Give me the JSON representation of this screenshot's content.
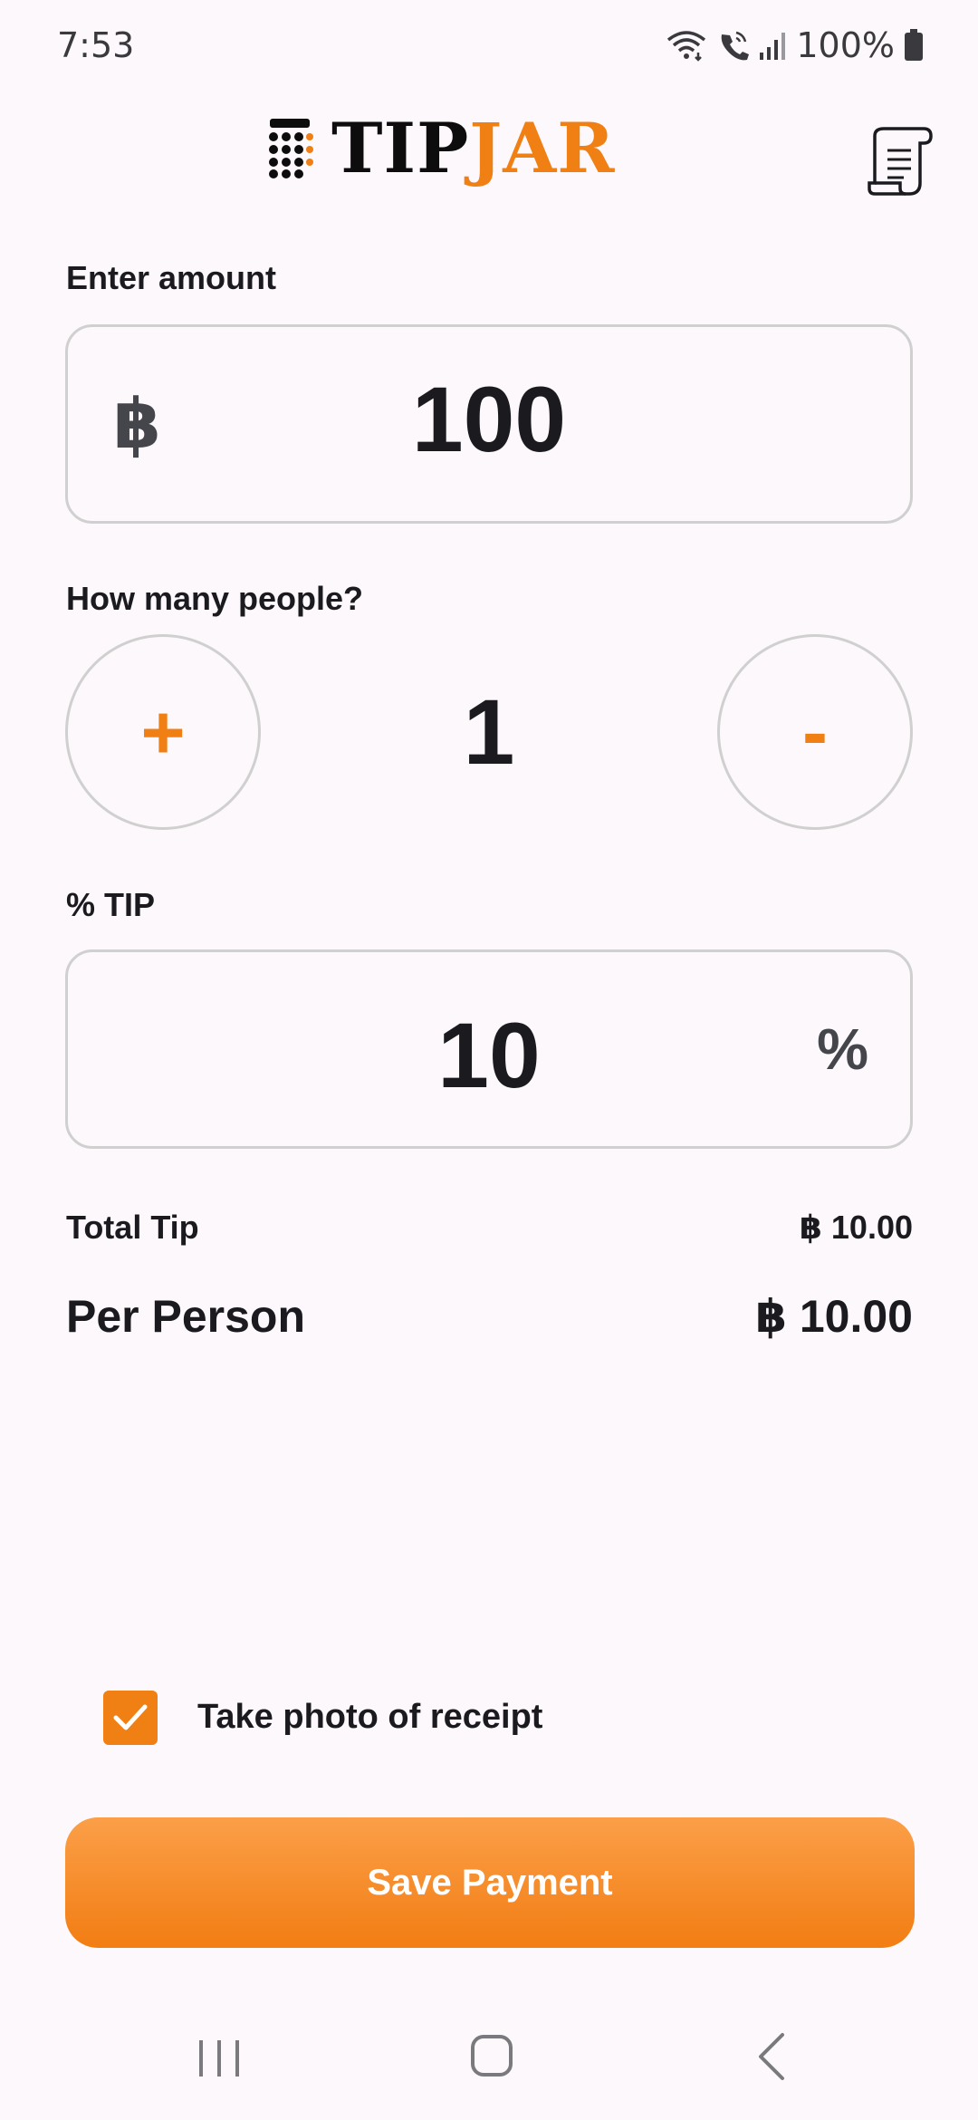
{
  "status_bar": {
    "time": "7:53",
    "battery": "100%",
    "icons": [
      "wifi-icon",
      "wifi-calling-icon",
      "signal-icon",
      "battery-icon"
    ]
  },
  "header": {
    "logo_part1": "TIP",
    "logo_part2": "JAR",
    "receipt_icon": "receipt-icon"
  },
  "amount": {
    "label": "Enter amount",
    "currency_symbol": "฿",
    "value": "100"
  },
  "people": {
    "label": "How many people?",
    "increment_label": "+",
    "decrement_label": "-",
    "count": "1"
  },
  "tip": {
    "label": "% TIP",
    "value": "10",
    "suffix": "%"
  },
  "summary": {
    "total_tip_label": "Total Tip",
    "total_tip_value": "฿ 10.00",
    "per_person_label": "Per Person",
    "per_person_value": "฿ 10.00"
  },
  "receipt_photo": {
    "checked": true,
    "label": "Take photo of receipt"
  },
  "save_button": {
    "label": "Save Payment"
  },
  "colors": {
    "accent": "#f07f14",
    "text": "#1b1b1f",
    "background": "#fdf8fb",
    "border": "#d0d0d0"
  },
  "nav_bar": {
    "icons": [
      "recent-apps-icon",
      "home-icon",
      "back-icon"
    ]
  }
}
